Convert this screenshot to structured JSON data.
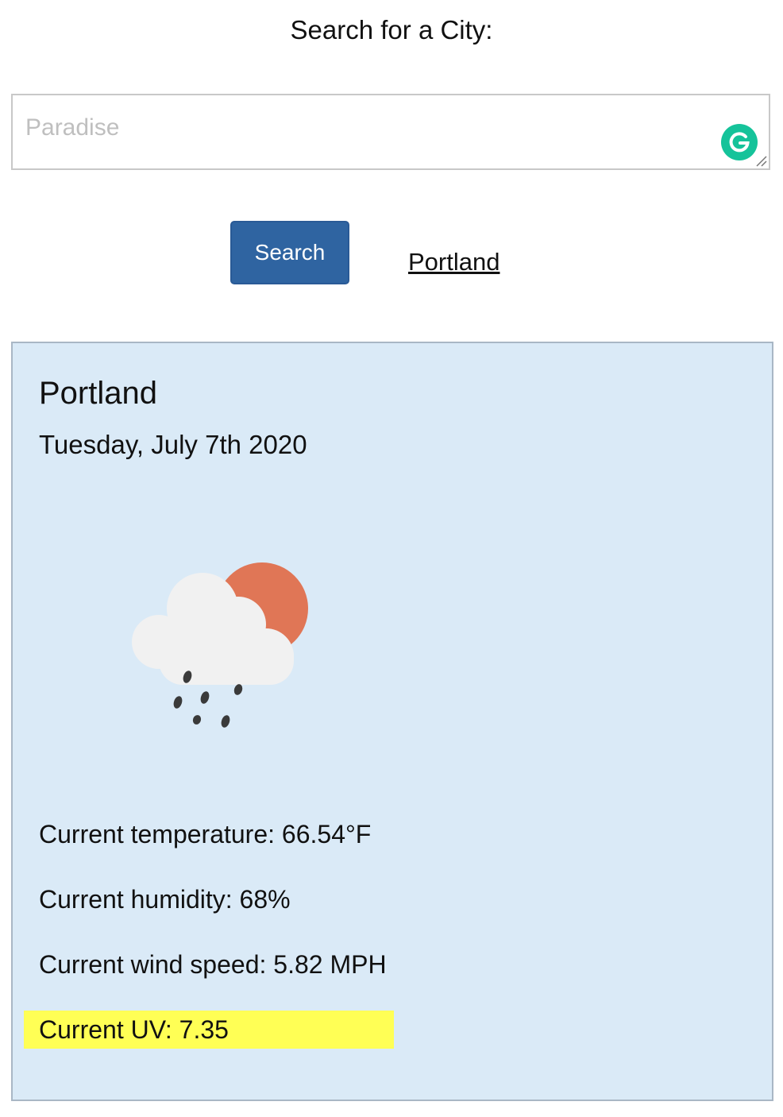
{
  "search": {
    "heading": "Search for a City:",
    "placeholder": "Paradise",
    "button_label": "Search"
  },
  "history": {
    "items": [
      {
        "label": "Portland"
      }
    ]
  },
  "weather": {
    "city": "Portland",
    "date": "Tuesday, July 7th 2020",
    "icon": "cloud-sun-rain-icon",
    "temperature": "Current temperature: 66.54°F",
    "humidity": "Current humidity: 68%",
    "wind_speed": "Current wind speed: 5.82 MPH",
    "uv": "Current UV: 7.35"
  },
  "colors": {
    "button": "#2f64a1",
    "card_background": "#daeaf7",
    "uv_highlight": "#ffff55",
    "sun": "#e07656",
    "grammarly_badge": "#15c39a"
  }
}
